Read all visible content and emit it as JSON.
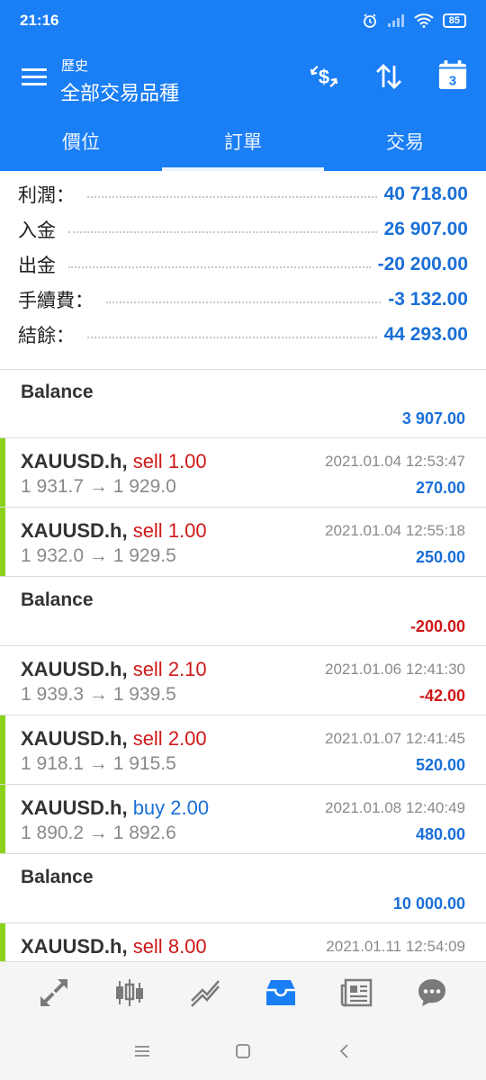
{
  "status": {
    "time": "21:16",
    "battery": "85"
  },
  "header": {
    "subtitle": "歷史",
    "title": "全部交易品種",
    "calendar_day": "3"
  },
  "tabs": [
    {
      "label": "價位",
      "active": false
    },
    {
      "label": "訂單",
      "active": true
    },
    {
      "label": "交易",
      "active": false
    }
  ],
  "summary": [
    {
      "label": "利潤：",
      "value": "40 718.00"
    },
    {
      "label": "入金",
      "value": "26 907.00"
    },
    {
      "label": "出金",
      "value": "-20 200.00"
    },
    {
      "label": "手續費：",
      "value": "-3 132.00"
    },
    {
      "label": "結餘：",
      "value": "44 293.00"
    }
  ],
  "entries": [
    {
      "kind": "balance",
      "title": "Balance",
      "amount": "3 907.00",
      "amount_color": "blue"
    },
    {
      "kind": "trade",
      "symbol": "XAUUSD.h,",
      "side": "sell",
      "volume": "1.00",
      "prices": "1 931.7 → 1 929.0",
      "date": "2021.01.04 12:53:47",
      "profit": "270.00",
      "profit_color": "blue",
      "bar": true
    },
    {
      "kind": "trade",
      "symbol": "XAUUSD.h,",
      "side": "sell",
      "volume": "1.00",
      "prices": "1 932.0 → 1 929.5",
      "date": "2021.01.04 12:55:18",
      "profit": "250.00",
      "profit_color": "blue",
      "bar": true
    },
    {
      "kind": "balance",
      "title": "Balance",
      "amount": "-200.00",
      "amount_color": "red"
    },
    {
      "kind": "trade",
      "symbol": "XAUUSD.h,",
      "side": "sell",
      "volume": "2.10",
      "prices": "1 939.3 → 1 939.5",
      "date": "2021.01.06 12:41:30",
      "profit": "-42.00",
      "profit_color": "red",
      "bar": false
    },
    {
      "kind": "trade",
      "symbol": "XAUUSD.h,",
      "side": "sell",
      "volume": "2.00",
      "prices": "1 918.1 → 1 915.5",
      "date": "2021.01.07 12:41:45",
      "profit": "520.00",
      "profit_color": "blue",
      "bar": true
    },
    {
      "kind": "trade",
      "symbol": "XAUUSD.h,",
      "side": "buy",
      "volume": "2.00",
      "prices": "1 890.2 → 1 892.6",
      "date": "2021.01.08 12:40:49",
      "profit": "480.00",
      "profit_color": "blue",
      "bar": true
    },
    {
      "kind": "balance",
      "title": "Balance",
      "amount": "10 000.00",
      "amount_color": "blue"
    },
    {
      "kind": "trade",
      "symbol": "XAUUSD.h,",
      "side": "sell",
      "volume": "8.00",
      "prices": "",
      "date": "2021.01.11 12:54:09",
      "profit": "",
      "profit_color": "blue",
      "bar": true
    }
  ],
  "bottom_nav": [
    {
      "icon": "quotes-arrows-icon",
      "active": false
    },
    {
      "icon": "candlestick-chart-icon",
      "active": false
    },
    {
      "icon": "trade-line-icon",
      "active": false
    },
    {
      "icon": "history-inbox-icon",
      "active": true
    },
    {
      "icon": "news-icon",
      "active": false
    },
    {
      "icon": "chat-bubble-icon",
      "active": false
    }
  ],
  "colors": {
    "primary": "#1a7ef5",
    "profit_blue": "#1a6fd8",
    "loss_red": "#d01818",
    "bar_green": "#8bd21a"
  }
}
